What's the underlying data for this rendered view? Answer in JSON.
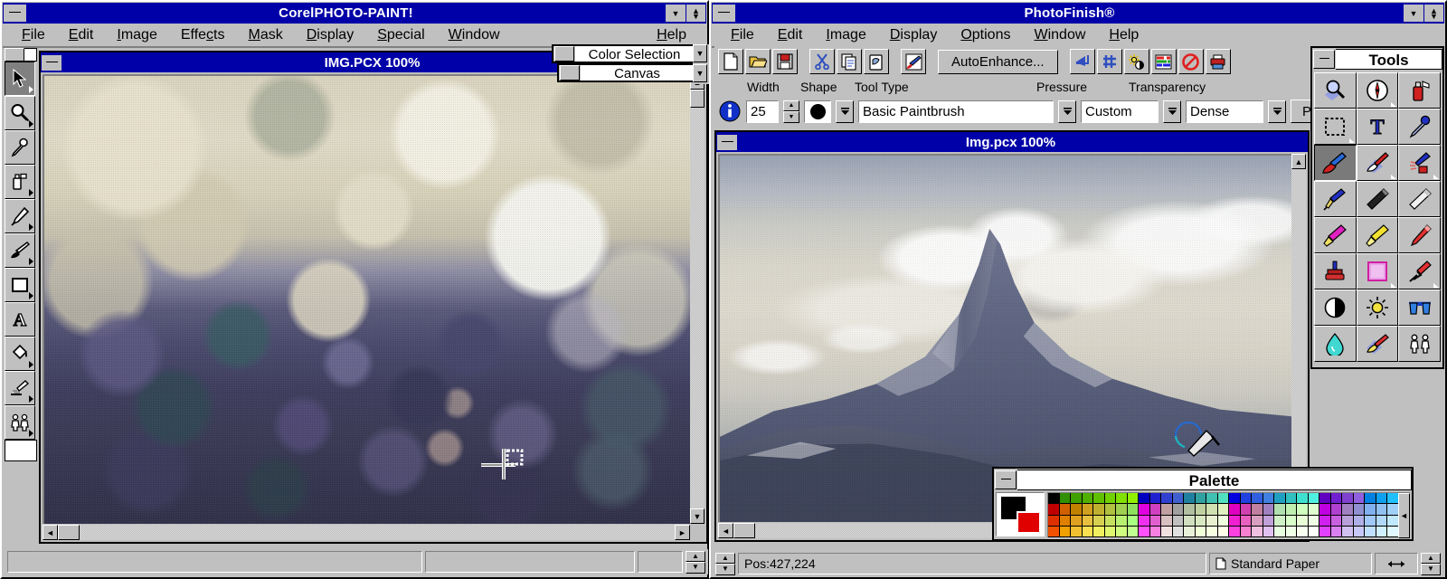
{
  "apps": {
    "corel": {
      "title": "CorelPHOTO-PAINT!",
      "menu": [
        "File",
        "Edit",
        "Image",
        "Effects",
        "Mask",
        "Display",
        "Special",
        "Window"
      ],
      "help_label": "Help",
      "document": {
        "title": "IMG.PCX  100%",
        "filename": "IMG.PCX",
        "zoom": "100%"
      },
      "toolbox": [
        {
          "name": "pick-tool",
          "icon": "arrow-icon",
          "selected": true
        },
        {
          "name": "zoom-tool",
          "icon": "magnifier-icon",
          "selected": false
        },
        {
          "name": "eyedropper-tool",
          "icon": "eyedropper-icon",
          "selected": false
        },
        {
          "name": "spraycan-tool",
          "icon": "spraycan-icon",
          "selected": false
        },
        {
          "name": "pen-tool",
          "icon": "pen-icon",
          "selected": false
        },
        {
          "name": "paintbrush-tool",
          "icon": "paintbrush-icon",
          "selected": false
        },
        {
          "name": "rectangle-tool",
          "icon": "rectangle-icon",
          "selected": false
        },
        {
          "name": "text-tool",
          "icon": "text-a-icon",
          "selected": false
        },
        {
          "name": "fill-tool",
          "icon": "paint-bucket-icon",
          "selected": false
        },
        {
          "name": "clone-tool",
          "icon": "clone-brush-icon",
          "selected": false
        },
        {
          "name": "people-tool",
          "icon": "people-icon",
          "selected": false
        }
      ],
      "floating_windows": [
        {
          "name": "color-selection-window",
          "title": "Color Selection"
        },
        {
          "name": "canvas-window",
          "title": "Canvas"
        }
      ],
      "status_panels": [
        "",
        "",
        ""
      ]
    },
    "photofinish": {
      "title": "PhotoFinish®",
      "menu": [
        "File",
        "Edit",
        "Image",
        "Display",
        "Options",
        "Window",
        "Help"
      ],
      "toolbar": [
        {
          "name": "new-button",
          "icon": "new-page-icon"
        },
        {
          "name": "open-button",
          "icon": "open-folder-icon"
        },
        {
          "name": "save-button",
          "icon": "floppy-disk-icon"
        },
        {
          "name": "cut-button",
          "icon": "scissors-icon"
        },
        {
          "name": "copy-button",
          "icon": "copy-pages-icon"
        },
        {
          "name": "paste-button",
          "icon": "paste-icon"
        },
        {
          "name": "retouch-button",
          "icon": "magic-brush-icon"
        },
        {
          "name": "autoenhance-button",
          "label": "AutoEnhance...",
          "icon": "autoenhance-button"
        },
        {
          "name": "flip-button",
          "icon": "flip-arrow-icon"
        },
        {
          "name": "sharpen-button",
          "icon": "sharpen-icon"
        },
        {
          "name": "brightness-button",
          "icon": "brightness-star-icon"
        },
        {
          "name": "color-balance-button",
          "icon": "rgb-sliders-icon"
        },
        {
          "name": "no-color-button",
          "icon": "no-entry-icon"
        },
        {
          "name": "print-button",
          "icon": "printer-icon"
        }
      ],
      "options": {
        "labels": {
          "width": "Width",
          "shape": "Shape",
          "tool_type": "Tool Type",
          "pressure": "Pressure",
          "transparency": "Transparency"
        },
        "width_value": "25",
        "shape_value": "round",
        "tool_type_value": "Basic Paintbrush",
        "pressure_value": "Custom",
        "transparency_value": "Dense",
        "paper_label": "Paper...",
        "info_icon": "info-circle-icon"
      },
      "document": {
        "title": "Img.pcx  100%",
        "filename": "Img.pcx",
        "zoom": "100%"
      },
      "tools_palette": {
        "title": "Tools",
        "tools": [
          {
            "name": "zoom-tool",
            "icon": "magnifier-icon",
            "selected": false,
            "has_flyout": false
          },
          {
            "name": "navigator-tool",
            "icon": "compass-icon",
            "selected": false,
            "has_flyout": true
          },
          {
            "name": "spraycan-tool",
            "icon": "spraycan-icon",
            "selected": false,
            "has_flyout": false
          },
          {
            "name": "select-tool",
            "icon": "marquee-icon",
            "selected": false,
            "has_flyout": true
          },
          {
            "name": "text-tool",
            "icon": "text-t-icon",
            "selected": false,
            "has_flyout": false
          },
          {
            "name": "eyedropper-tool",
            "icon": "eyedropper-icon",
            "selected": false,
            "has_flyout": false
          },
          {
            "name": "paintbrush-tool",
            "icon": "paintbrush-icon",
            "selected": true,
            "has_flyout": false
          },
          {
            "name": "eraser-tool",
            "icon": "eraser-brush-icon",
            "selected": false,
            "has_flyout": true
          },
          {
            "name": "airbrush-tool",
            "icon": "airbrush-icon",
            "selected": false,
            "has_flyout": true
          },
          {
            "name": "pen-tool",
            "icon": "fountain-pen-icon",
            "selected": false,
            "has_flyout": false
          },
          {
            "name": "charcoal-tool",
            "icon": "charcoal-stick-icon",
            "selected": false,
            "has_flyout": false
          },
          {
            "name": "chalk-tool",
            "icon": "chalk-icon",
            "selected": false,
            "has_flyout": false
          },
          {
            "name": "marker-tool",
            "icon": "magenta-marker-icon",
            "selected": false,
            "has_flyout": false
          },
          {
            "name": "highlighter-tool",
            "icon": "yellow-highlighter-icon",
            "selected": false,
            "has_flyout": false
          },
          {
            "name": "lipstick-tool",
            "icon": "red-crayon-icon",
            "selected": false,
            "has_flyout": false
          },
          {
            "name": "stamp-tool",
            "icon": "rubber-stamp-icon",
            "selected": false,
            "has_flyout": false
          },
          {
            "name": "fill-tool",
            "icon": "pattern-square-icon",
            "selected": false,
            "has_flyout": true
          },
          {
            "name": "clone-tool",
            "icon": "clone-dropper-icon",
            "selected": false,
            "has_flyout": true
          },
          {
            "name": "contrast-tool",
            "icon": "contrast-circle-icon",
            "selected": false,
            "has_flyout": false
          },
          {
            "name": "brightness-tool",
            "icon": "sun-icon",
            "selected": false,
            "has_flyout": false
          },
          {
            "name": "glasses-tool",
            "icon": "blue-glasses-icon",
            "selected": false,
            "has_flyout": false
          },
          {
            "name": "smudge-tool",
            "icon": "water-drop-icon",
            "selected": false,
            "has_flyout": false
          },
          {
            "name": "retouch-tool",
            "icon": "retouch-brush-icon",
            "selected": false,
            "has_flyout": false
          },
          {
            "name": "people-tool",
            "icon": "people-icon",
            "selected": false,
            "has_flyout": false
          }
        ]
      },
      "palette_window": {
        "title": "Palette",
        "foreground_color": "#000000",
        "background_color": "#e00000"
      },
      "status": {
        "position": "Pos:427,224",
        "paper": "Standard Paper",
        "paper_icon": "page-icon",
        "resize_icon": "horizontal-resize-icon"
      }
    }
  },
  "colors": {
    "titlebar_active": "#0000a8",
    "face": "#c0c0c0",
    "shadow": "#808080",
    "highlight": "#ffffff"
  },
  "palette_swatches": [
    "#000000",
    "#c00000",
    "#e03000",
    "#f05000",
    "#309000",
    "#d06000",
    "#e08000",
    "#f0a000",
    "#40a000",
    "#c08000",
    "#e0a020",
    "#f0c030",
    "#50b000",
    "#d0a020",
    "#e8c040",
    "#f8e050",
    "#60c000",
    "#c0b030",
    "#d8d050",
    "#f0f060",
    "#70d000",
    "#b0c040",
    "#c8e060",
    "#e0f870",
    "#80e000",
    "#a0d050",
    "#b8f070",
    "#d0ff80",
    "#90f000",
    "#90e060",
    "#a8ff80",
    "#c0ff90",
    "#0000c0",
    "#e000e0",
    "#f030f0",
    "#ff50ff",
    "#2020d0",
    "#d040c0",
    "#e060d0",
    "#f880e0",
    "#3040d0",
    "#c0a0a0",
    "#d8c0c0",
    "#f0e0e0",
    "#4060d0",
    "#a0a0a0",
    "#c0c0c0",
    "#e0e0e0",
    "#2080a0",
    "#b0c0a0",
    "#d0e0c0",
    "#e8f0d8",
    "#30a0a0",
    "#c0d0a0",
    "#d8e8c0",
    "#f0ffd8",
    "#40c0b0",
    "#d0e0b0",
    "#e8f0d0",
    "#f8ffe0",
    "#50e0c0",
    "#e0f0c0",
    "#f0ffe0",
    "#ffffe8",
    "#0000e0",
    "#e000c0",
    "#f020d0",
    "#ff40e0",
    "#2040e0",
    "#d040b0",
    "#e860c0",
    "#f880d0",
    "#3060e0",
    "#c080a0",
    "#d8a0c0",
    "#f0c0e0",
    "#4080e0",
    "#a080c0",
    "#c0a0d8",
    "#e0c0f0",
    "#20a0c0",
    "#b0e0b0",
    "#d0f0c8",
    "#e8ffe0",
    "#30c0c0",
    "#c0f0b0",
    "#d8ffc8",
    "#f0ffe8",
    "#40e0d0",
    "#d0ffc0",
    "#e8ffd8",
    "#f8fff0",
    "#50f0e0",
    "#e0ffd0",
    "#f0ffe8",
    "#ffffff",
    "#6000c0",
    "#c000e0",
    "#d020f0",
    "#e040ff",
    "#7020d0",
    "#b040d0",
    "#c860e0",
    "#d880f0",
    "#8040d0",
    "#a080c0",
    "#b8a0d8",
    "#d0c0f0",
    "#9060e0",
    "#9090d0",
    "#b0b0e8",
    "#c8c8f8",
    "#0080e0",
    "#80b0f0",
    "#a0c8f8",
    "#c0e0ff",
    "#10a0f0",
    "#90c0f0",
    "#b0d8f8",
    "#d0f0ff",
    "#20c0ff",
    "#a0d0f8",
    "#c0e8ff",
    "#e0f8ff",
    "#30e0ff",
    "#b0e0ff",
    "#d0f0ff",
    "#f0ffff"
  ]
}
